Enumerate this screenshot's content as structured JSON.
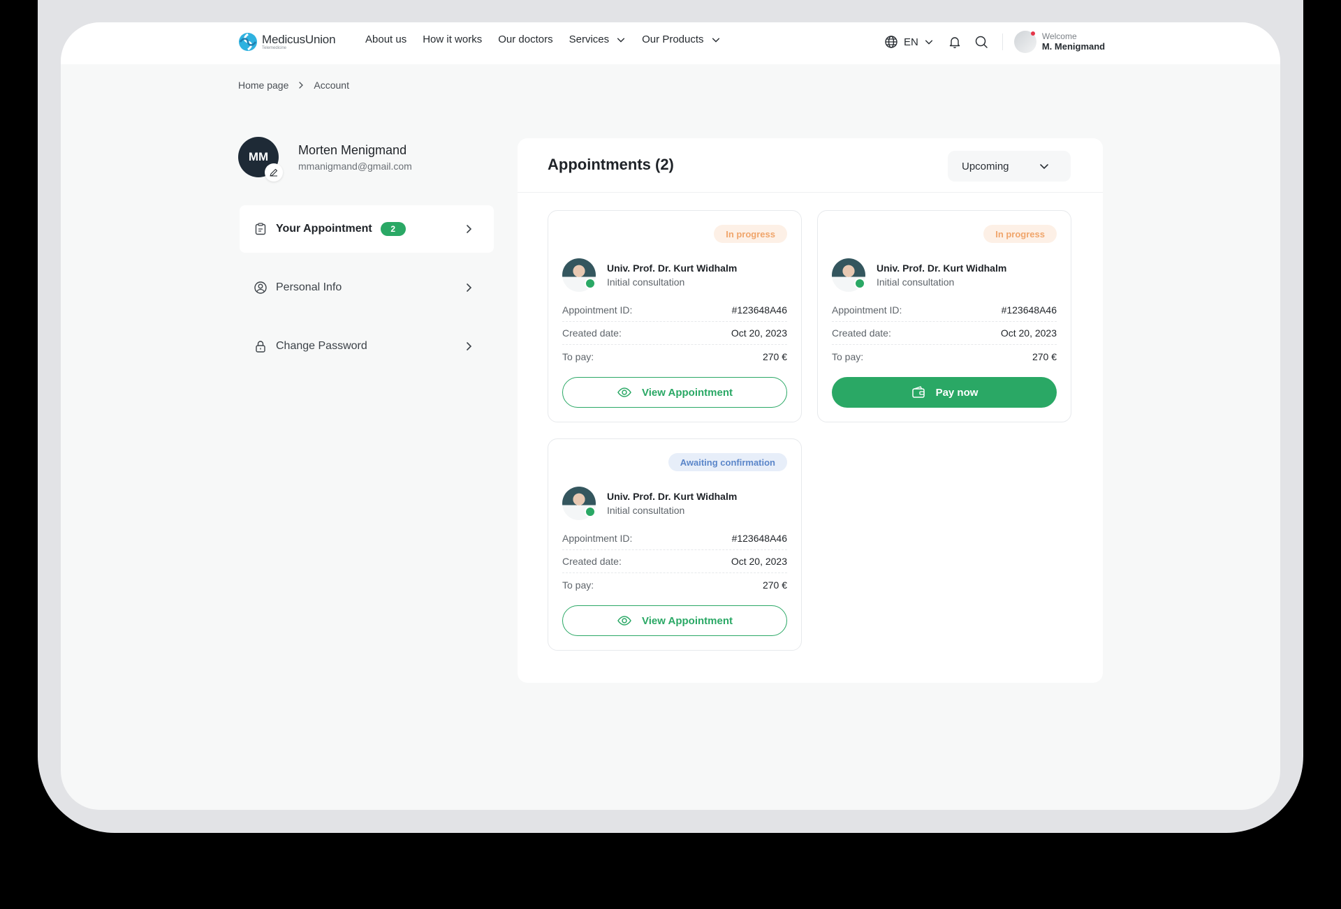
{
  "colors": {
    "accent": "#2aa865",
    "progress_bg": "#fdf0e6",
    "progress_text": "#f0a56b",
    "await_bg": "#e7eef9",
    "await_text": "#5b86c9"
  },
  "brand": {
    "name": "MedicusUnion",
    "tagline": "Telemedicine"
  },
  "nav": [
    {
      "label": "About us"
    },
    {
      "label": "How it works"
    },
    {
      "label": "Our doctors"
    },
    {
      "label": "Services"
    },
    {
      "label": "Our Products"
    }
  ],
  "header": {
    "language": "EN",
    "welcome": "Welcome",
    "user_name": "M. Menigmand"
  },
  "breadcrumb": {
    "home": "Home page",
    "current": "Account"
  },
  "profile": {
    "initials": "MM",
    "name": "Morten Menigmand",
    "email": "mmanigmand@gmail.com"
  },
  "sidebar": {
    "items": [
      {
        "label": "Your Appointment",
        "badge": "2",
        "icon": "clipboard-icon"
      },
      {
        "label": "Personal Info",
        "icon": "user-circle-icon"
      },
      {
        "label": "Change Password",
        "icon": "lock-icon"
      }
    ]
  },
  "appointments": {
    "title": "Appointments (2)",
    "filter": "Upcoming",
    "labels": {
      "id": "Appointment ID:",
      "created": "Created date:",
      "pay": "To pay:"
    },
    "cards": [
      {
        "status": "In progress",
        "doctor": "Univ. Prof. Dr. Kurt Widhalm",
        "type": "Initial consultation",
        "id": "#123648A46",
        "created": "Oct 20, 2023",
        "pay": "270 €",
        "action": "View Appointment"
      },
      {
        "status": "In progress",
        "doctor": "Univ. Prof. Dr. Kurt Widhalm",
        "type": "Initial consultation",
        "id": "#123648A46",
        "created": "Oct 20, 2023",
        "pay": "270 €",
        "action": "Pay now"
      },
      {
        "status": "Awaiting confirmation",
        "doctor": "Univ. Prof. Dr. Kurt Widhalm",
        "type": "Initial consultation",
        "id": "#123648A46",
        "created": "Oct 20, 2023",
        "pay": "270 €",
        "action": "View Appointment"
      }
    ]
  }
}
